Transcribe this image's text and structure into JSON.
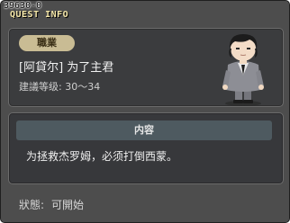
{
  "window": {
    "quest_id": "39630-0",
    "title": "QUEST INFO"
  },
  "job": {
    "tag": "職業",
    "quest_name": "[阿貸尔] 为了主君",
    "level_requirement": "建議等级: 30〜34",
    "portrait_icon": "npc-portrait-icon"
  },
  "content": {
    "header": "内容",
    "text": "为拯救杰罗姆，必须打倒西蒙。"
  },
  "status": {
    "label": "狀態:",
    "value": "可開始"
  },
  "colors": {
    "window_bg": "#4d4d4d",
    "title": "#f4e6a8",
    "job_tag_bg": "#c9bc94",
    "content_header_bg": "#4e5a60"
  }
}
